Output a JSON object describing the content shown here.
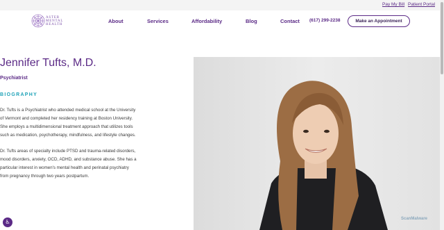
{
  "topbar": {
    "pay_bill": "Pay My Bill",
    "patient_portal": "Patient Portal"
  },
  "logo": {
    "line1": "ASTER",
    "line2": "MENTAL",
    "line3": "HEALTH"
  },
  "nav": {
    "items": [
      {
        "label": "About"
      },
      {
        "label": "Services"
      },
      {
        "label": "Affordability"
      },
      {
        "label": "Blog"
      },
      {
        "label": "Contact"
      }
    ],
    "phone": "(617) 299-2238",
    "cta": "Make an Appointment"
  },
  "profile": {
    "name": "Jennifer Tufts, M.D.",
    "role": "Psychiatrist",
    "bio_heading": "BIOGRAPHY",
    "paragraph1": [
      "Dr. Tufts is a Psychiatrist who attended medical school at the University",
      "of Vermont and completed her residency training at Boston University.",
      "She employs a multidimensional treatment approach that utilizes tools",
      "such as medication, psychotherapy, mindfulness, and lifestyle changes."
    ],
    "paragraph2": [
      "Dr. Tufts areas of specialty include PTSD and trauma-related disorders,",
      "mood disorders, anxiety, OCD, ADHD, and substance abuse. She has a",
      "particular interest in women's mental health and perinatal psychiatry",
      "from pregnancy through two years postpartum."
    ]
  },
  "watermark": "ScanMalware",
  "icons": {
    "logo": "aster-flower-icon",
    "accessibility": "accessibility-icon"
  },
  "colors": {
    "brand": "#5b2a86",
    "accent": "#1fa3b8"
  }
}
